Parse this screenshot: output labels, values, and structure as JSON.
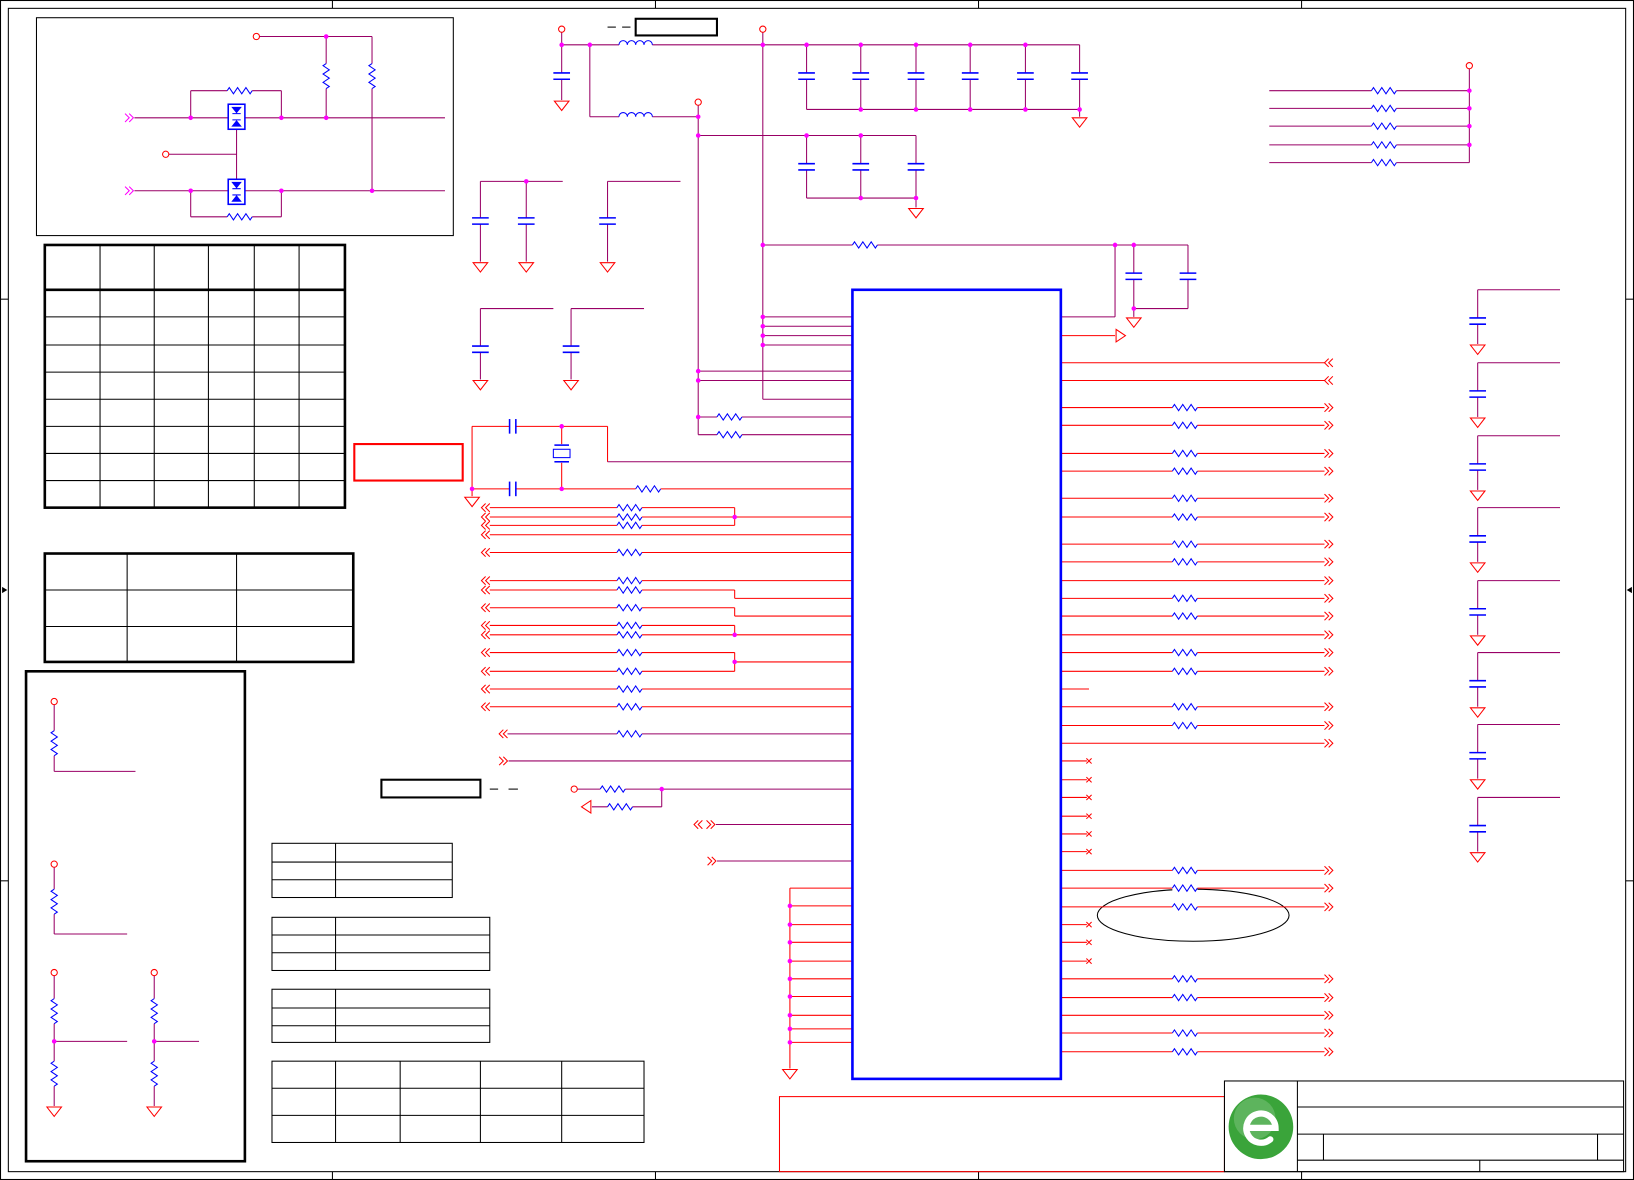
{
  "colors": {
    "wire_power": "#990066",
    "wire_signal": "#ff0000",
    "component": "#0000ff",
    "ic_outline": "#0000ff",
    "junction": "#ff00ff",
    "frame": "#000000",
    "logo": "#3aa43a",
    "logo_mark": "#ffffff",
    "background": "#ffffff"
  },
  "icons": {
    "logo": "company-logo-icon",
    "port_in": "port-arrow-left-icon",
    "port_out": "port-arrow-right-icon",
    "ground": "ground-symbol",
    "no_connect": "no-connect-marker"
  }
}
